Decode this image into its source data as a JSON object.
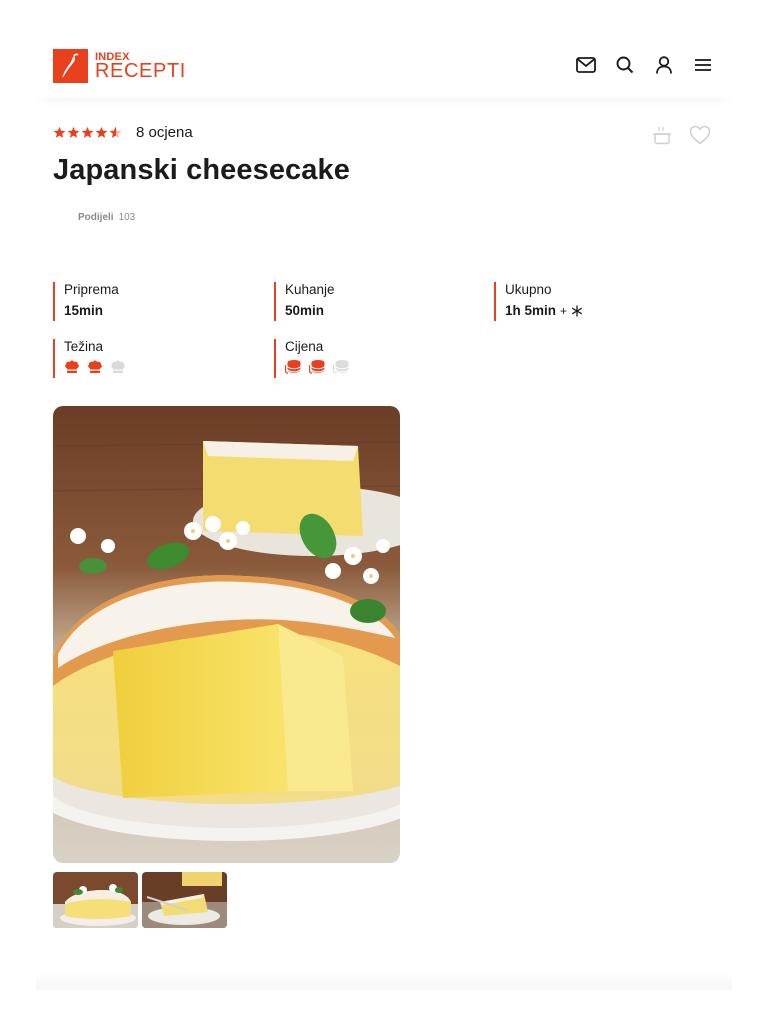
{
  "header": {
    "logo_small": "INDEX",
    "logo_main": "RECEPTI",
    "icons": [
      "mail-icon",
      "search-icon",
      "user-icon",
      "menu-icon"
    ]
  },
  "recipe": {
    "rating_stars": 4.5,
    "rating_count_text": "8 ocjena",
    "title": "Japanski cheesecake",
    "share_label": "Podijeli",
    "share_count": "103"
  },
  "info": {
    "priprema": {
      "label": "Priprema",
      "value": "15min"
    },
    "kuhanje": {
      "label": "Kuhanje",
      "value": "50min"
    },
    "ukupno": {
      "label": "Ukupno",
      "value": "1h 5min",
      "extra": "+",
      "extra_icon": "snowflake-icon"
    },
    "tezina": {
      "label": "Težina",
      "level": 2,
      "max": 3,
      "icon": "chef-hat-icon"
    },
    "cijena": {
      "label": "Cijena",
      "level": 2,
      "max": 3,
      "icon": "coins-icon"
    }
  },
  "colors": {
    "accent": "#e8401c",
    "muted": "#d6d6d6"
  },
  "gallery": {
    "thumbnails": 2
  }
}
